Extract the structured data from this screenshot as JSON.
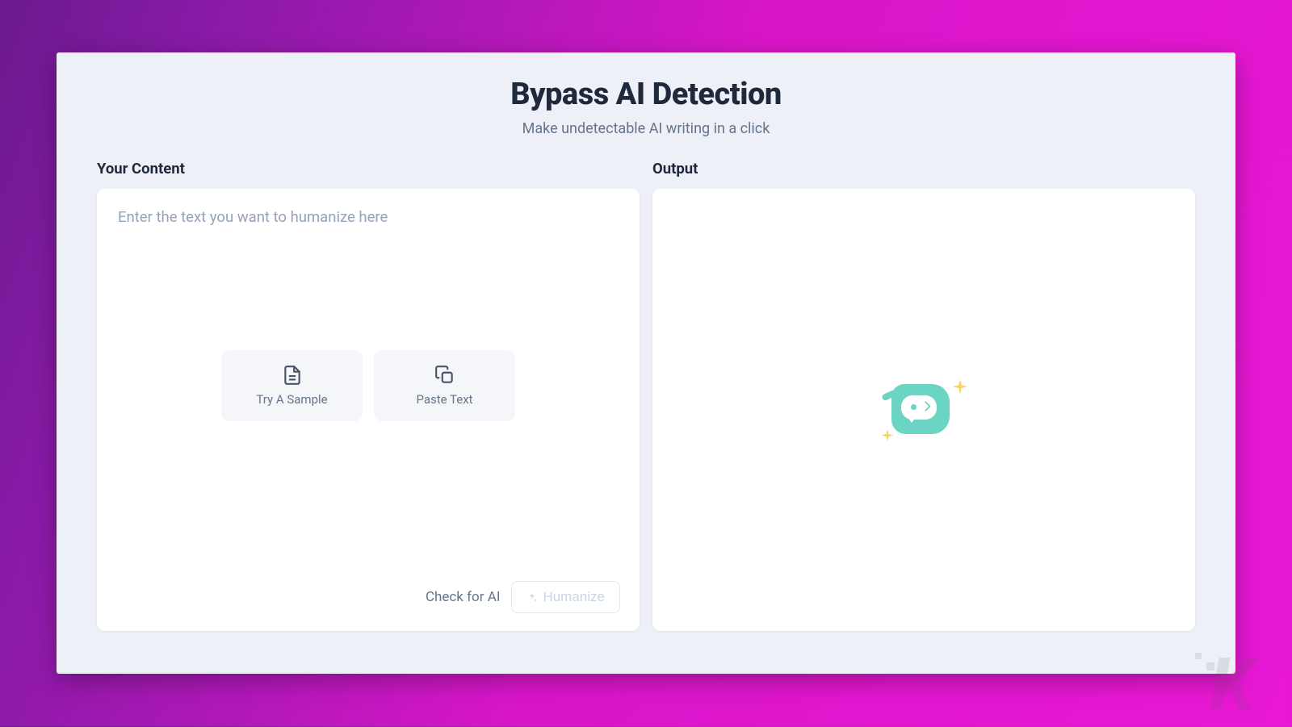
{
  "header": {
    "title": "Bypass AI Detection",
    "subtitle": "Make undetectable AI writing in a click"
  },
  "input_section": {
    "label": "Your Content",
    "placeholder": "Enter the text you want to humanize here",
    "try_sample_label": "Try A Sample",
    "paste_text_label": "Paste Text",
    "check_for_ai_label": "Check for AI",
    "humanize_label": "Humanize"
  },
  "output_section": {
    "label": "Output"
  }
}
